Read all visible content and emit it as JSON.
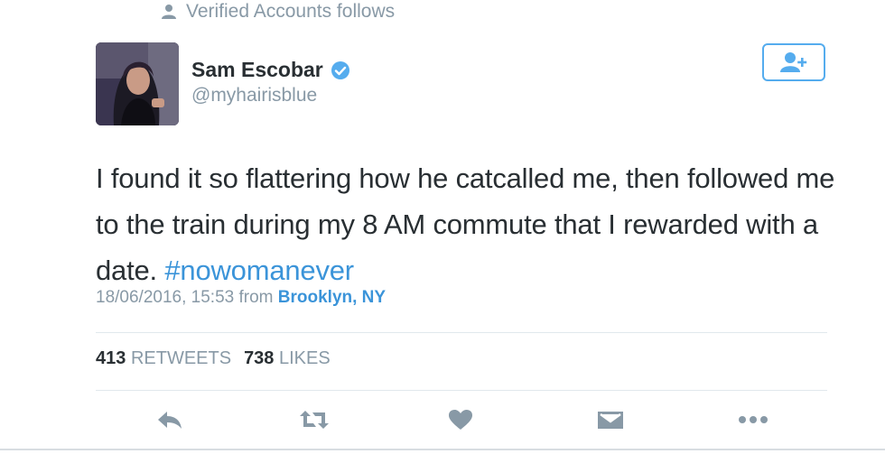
{
  "context": {
    "text": "Verified Accounts follows",
    "icon": "person-icon"
  },
  "author": {
    "name": "Sam Escobar",
    "handle": "@myhairisblue",
    "verified": true,
    "verified_color": "#55acee"
  },
  "follow_button": {
    "icon": "add-user-icon",
    "accent": "#55acee"
  },
  "tweet": {
    "text": "I found it so flattering how he catcalled me, then followed me to the train during my 8 AM commute that I rewarded with a date.",
    "hashtag": "#nowomanever",
    "timestamp": "18/06/2016, 15:53",
    "from_label": "from",
    "location": "Brooklyn, NY"
  },
  "stats": {
    "retweets_count": "413",
    "retweets_label": "RETWEETS",
    "likes_count": "738",
    "likes_label": "LIKES"
  },
  "actions": [
    {
      "name": "reply",
      "icon": "reply-icon"
    },
    {
      "name": "retweet",
      "icon": "retweet-icon"
    },
    {
      "name": "like",
      "icon": "heart-icon"
    },
    {
      "name": "message",
      "icon": "envelope-icon"
    },
    {
      "name": "more",
      "icon": "more-icon"
    }
  ],
  "colors": {
    "text": "#292f33",
    "muted": "#8899a6",
    "link": "#3b94d9",
    "divider": "#e1e8ed"
  }
}
